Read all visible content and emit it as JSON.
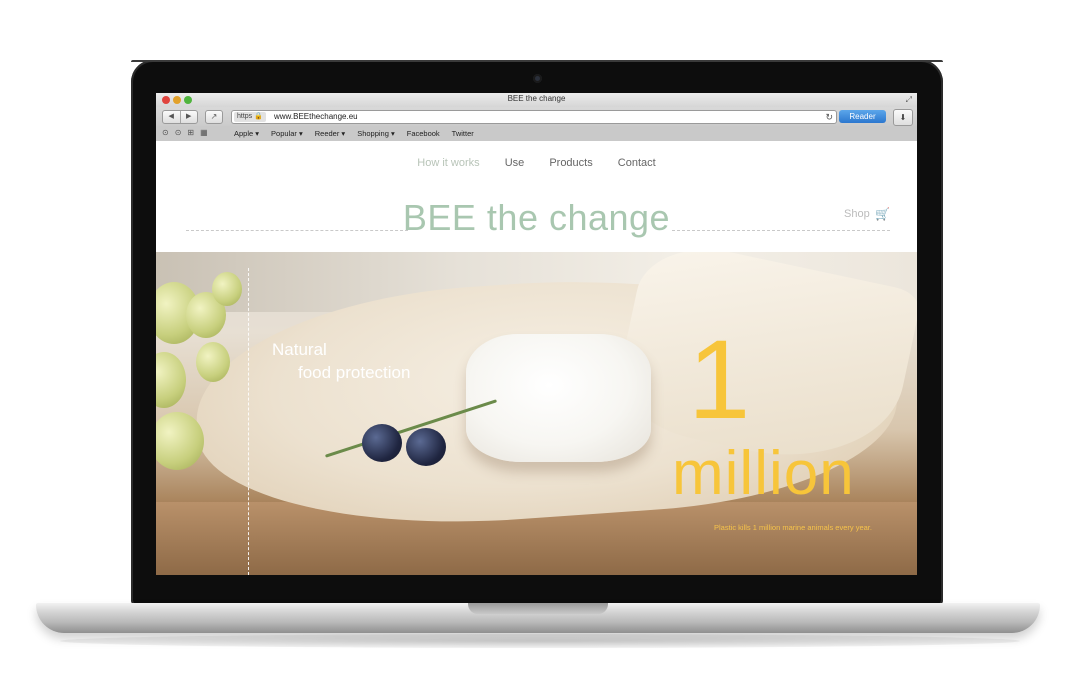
{
  "browser": {
    "window_title": "BEE the change",
    "address_scheme": "https",
    "url": "www.BEEthechange.eu",
    "reader_label": "Reader",
    "bookmarks": [
      "Apple ▾",
      "Popular ▾",
      "Reeder ▾",
      "Shopping ▾",
      "Facebook",
      "Twitter"
    ]
  },
  "site": {
    "nav": [
      "How it works",
      "Use",
      "Products",
      "Contact"
    ],
    "brand": "BEE the change",
    "shop_label": "Shop",
    "hero": {
      "tagline_line1": "Natural",
      "tagline_line2": "food protection",
      "stat_number": "1",
      "stat_unit": "million",
      "stat_caption": "Plastic kills 1 million marine animals every year."
    }
  },
  "colors": {
    "brand_green": "#a9c7b0",
    "stat_yellow": "#f7c53a",
    "reader_blue": "#2b77cf"
  }
}
